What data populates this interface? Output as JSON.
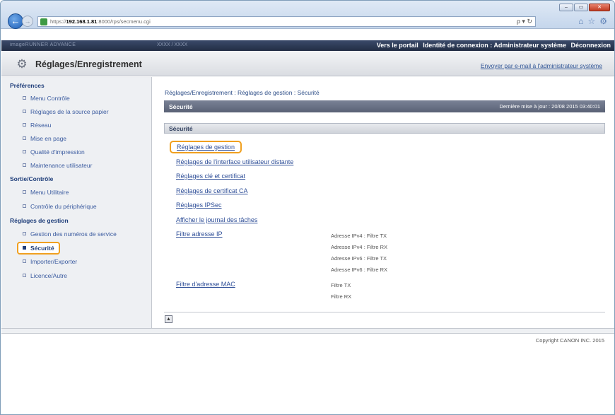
{
  "browser": {
    "url_prefix": "https://",
    "url_host": "192.168.1.81",
    "url_rest": ":8000/rps/secmenu.cgi",
    "search_glyph": "ρ ▾ ↻"
  },
  "topbar": {
    "device_label": "imageRUNNER ADVANCE",
    "model_label": "XXXX / XXXX",
    "portal_link": "Vers le portail",
    "login_label": "Identité de connexion : Administrateur système",
    "logout_link": "Déconnexion"
  },
  "header": {
    "title": "Réglages/Enregistrement",
    "email_link": "Envoyer par e-mail à l'administrateur système"
  },
  "sidebar": {
    "sections": [
      {
        "title": "Préférences",
        "items": [
          "Menu Contrôle",
          "Réglages de la source papier",
          "Réseau",
          "Mise en page",
          "Qualité d'impression",
          "Maintenance utilisateur"
        ]
      },
      {
        "title": "Sortie/Contrôle",
        "items": [
          "Menu Utilitaire",
          "Contrôle du périphérique"
        ]
      },
      {
        "title": "Réglages de gestion",
        "items": [
          "Gestion des numéros de service",
          "Sécurité",
          "Importer/Exporter",
          "Licence/Autre"
        ]
      }
    ]
  },
  "main": {
    "breadcrumb": "Réglages/Enregistrement : Réglages de gestion : Sécurité",
    "page_title": "Sécurité",
    "last_update": "Dernière mise à jour : 20/08 2015 03:40:01",
    "section_title": "Sécurité",
    "links": [
      "Réglages de gestion",
      "Réglages de l'interface utilisateur distante",
      "Réglages clé et certificat",
      "Réglages de certificat CA",
      "Réglages IPSec",
      "Afficher le journal des tâches",
      "Filtre adresse IP",
      "Filtre d'adresse MAC"
    ],
    "ip_filters": [
      "Adresse IPv4 : Filtre TX",
      "Adresse IPv4 : Filtre RX",
      "Adresse IPv6 : Filtre TX",
      "Adresse IPv6 : Filtre RX"
    ],
    "mac_filters": [
      "Filtre TX",
      "Filtre RX"
    ]
  },
  "footer": {
    "copyright": "Copyright CANON INC. 2015"
  }
}
